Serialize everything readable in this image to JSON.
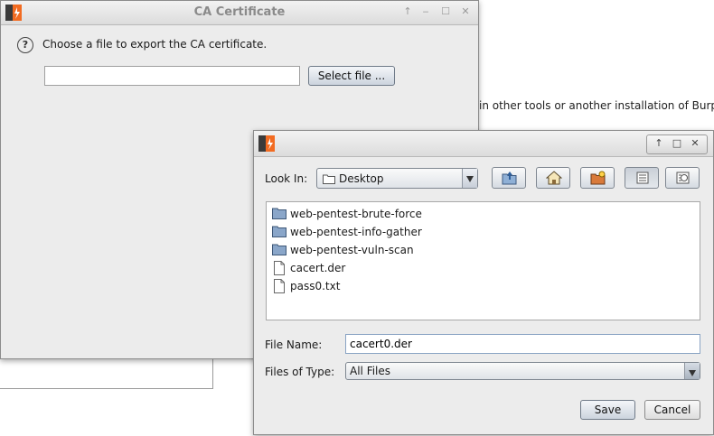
{
  "background": {
    "text": "in other tools or another installation of Burp."
  },
  "ca_dialog": {
    "title": "CA Certificate",
    "message": "Choose a file to export the CA certificate.",
    "file_path_value": "",
    "select_file_label": "Select file ..."
  },
  "save_dialog": {
    "look_in_label": "Look In:",
    "look_in_value": "Desktop",
    "files": [
      {
        "name": "web-pentest-brute-force",
        "type": "folder"
      },
      {
        "name": "web-pentest-info-gather",
        "type": "folder"
      },
      {
        "name": "web-pentest-vuln-scan",
        "type": "folder"
      },
      {
        "name": "cacert.der",
        "type": "file"
      },
      {
        "name": "pass0.txt",
        "type": "file"
      }
    ],
    "file_name_label": "File Name:",
    "file_name_value": "cacert0.der",
    "files_of_type_label": "Files of Type:",
    "files_of_type_value": "All Files",
    "save_label": "Save",
    "cancel_label": "Cancel"
  },
  "colors": {
    "logo_orange": "#f26b21",
    "logo_dark": "#3a3a3a",
    "folder_blue": "#7f9cc0",
    "accent_border": "#8aa4c4"
  }
}
